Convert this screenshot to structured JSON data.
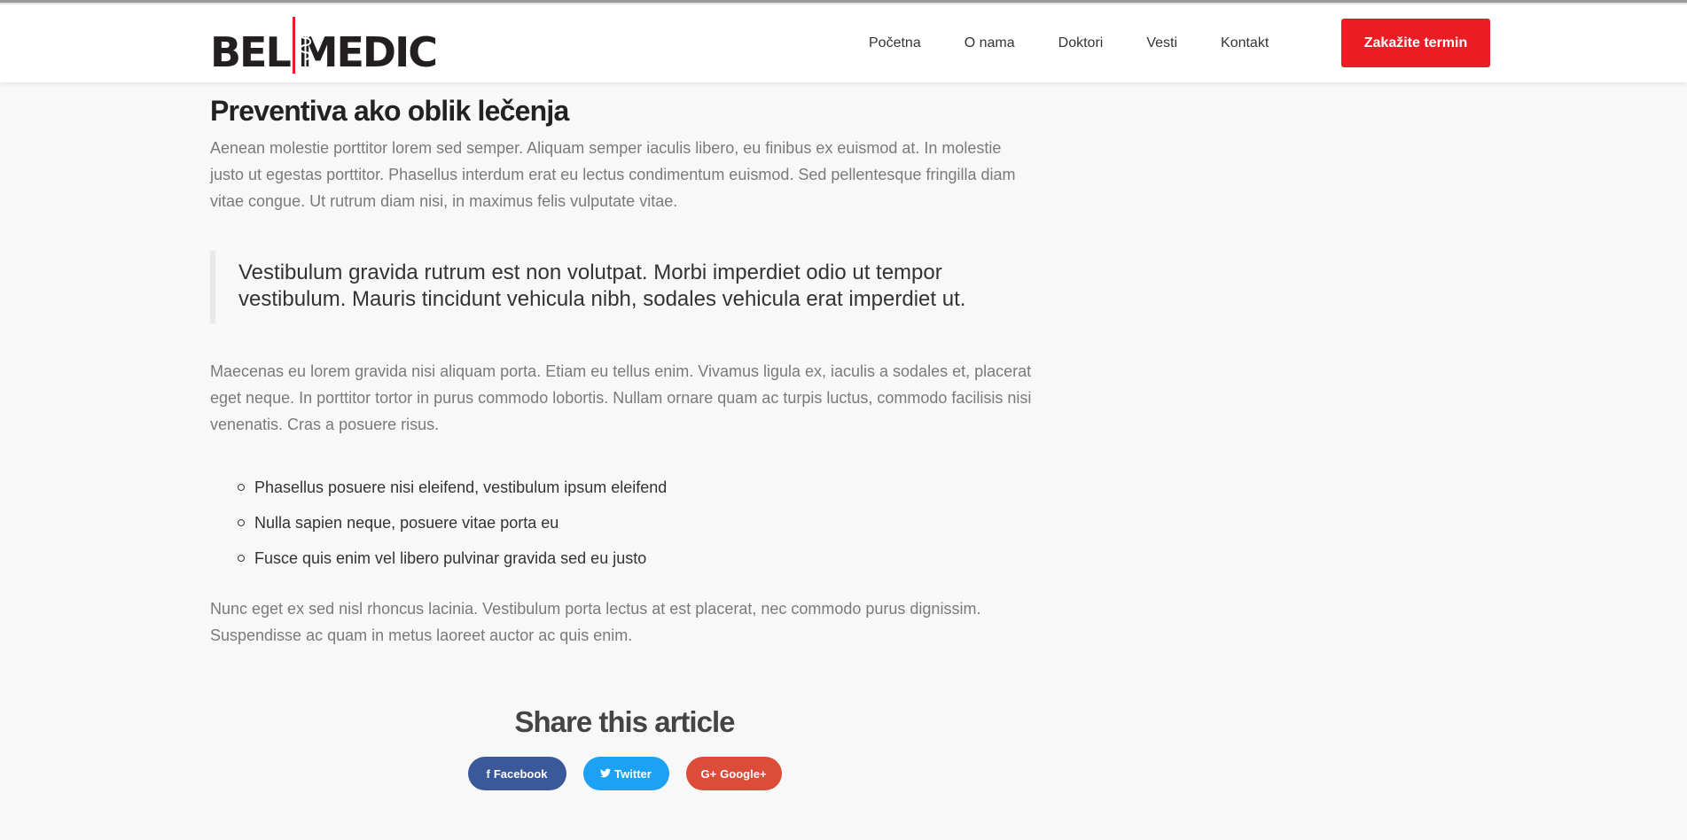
{
  "brand": {
    "left": "BEL",
    "right": "MEDIC",
    "mark_color": "#ed1c24"
  },
  "nav": {
    "items": [
      "Početna",
      "O nama",
      "Doktori",
      "Vesti",
      "Kontakt"
    ],
    "cta": "Zakažite termin"
  },
  "article": {
    "title": "Preventiva ako oblik lečenja",
    "intro": "Aenean molestie porttitor lorem sed semper. Aliquam semper iaculis libero, eu finibus ex euismod at. In molestie justo ut egestas porttitor. Phasellus interdum erat eu lectus condimentum euismod. Sed pellentesque fringilla diam vitae congue. Ut rutrum diam nisi, in maximus felis vulputate vitae.",
    "quote": "Vestibulum gravida rutrum est non volutpat. Morbi imperdiet odio ut tempor vestibulum. Mauris tincidunt vehicula nibh, sodales vehicula erat imperdiet ut.",
    "paragraph2": "Maecenas eu lorem gravida nisi aliquam porta. Etiam eu tellus enim. Vivamus ligula ex, iaculis a sodales et, placerat eget neque. In porttitor tortor in purus commodo lobortis. Nullam ornare quam ac turpis luctus, commodo facilisis nisi venenatis. Cras a posuere risus.",
    "bullets": [
      "Phasellus posuere nisi eleifend, vestibulum ipsum eleifend",
      "Nulla sapien neque, posuere vitae porta eu",
      "Fusce quis enim vel libero pulvinar gravida sed eu justo"
    ],
    "paragraph3": "Nunc eget ex sed nisl rhoncus lacinia. Vestibulum porta lectus at est placerat, nec commodo purus dignissim. Suspendisse ac quam in metus laoreet auctor ac quis enim."
  },
  "share": {
    "heading": "Share this article",
    "facebook": "Facebook",
    "twitter": "Twitter",
    "google": "Google+",
    "facebook_icon": "f",
    "twitter_icon": "🐦",
    "google_icon": "G+",
    "colors": {
      "facebook": "#3b5998",
      "twitter": "#1da1f2",
      "google": "#dd4b39",
      "cta": "#ed1c24"
    }
  }
}
